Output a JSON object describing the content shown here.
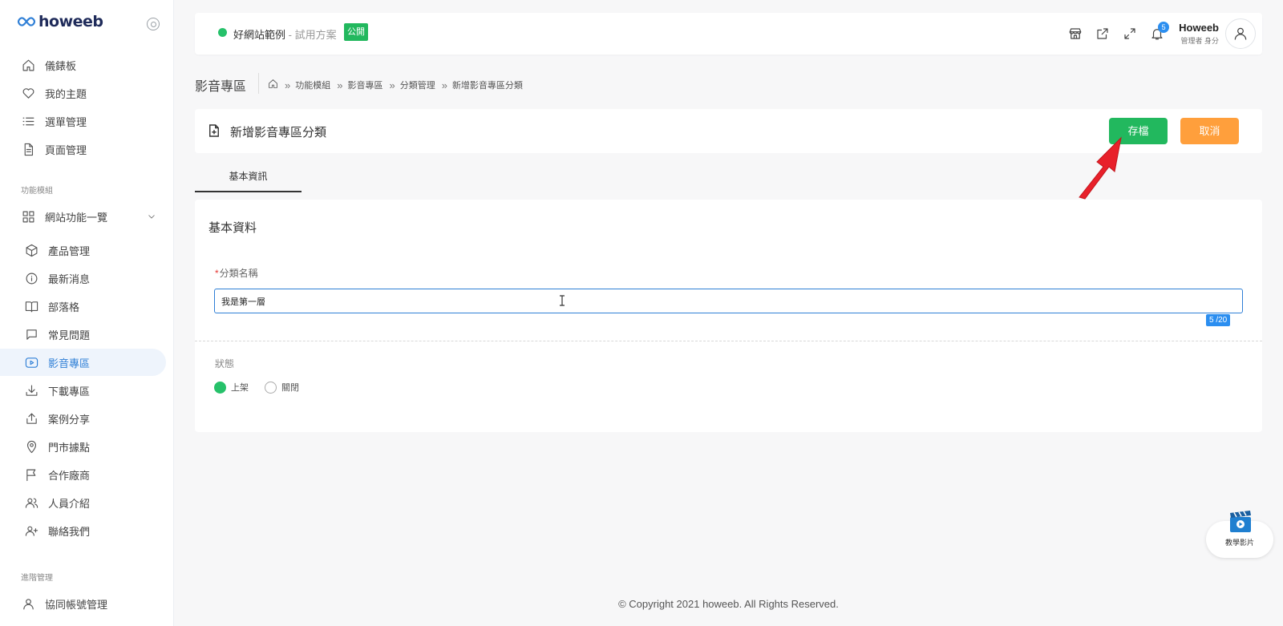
{
  "brand": {
    "logo_text": "howeeb"
  },
  "sidebar": {
    "main_items": [
      {
        "label": "儀錶板",
        "icon": "home-icon"
      },
      {
        "label": "我的主題",
        "icon": "heart-icon"
      },
      {
        "label": "選單管理",
        "icon": "list-icon"
      },
      {
        "label": "頁面管理",
        "icon": "file-icon"
      }
    ],
    "section_modules": "功能模組",
    "group_label": "網站功能一覽",
    "module_items": [
      {
        "label": "產品管理",
        "icon": "box-icon"
      },
      {
        "label": "最新消息",
        "icon": "info-icon"
      },
      {
        "label": "部落格",
        "icon": "book-icon"
      },
      {
        "label": "常見問題",
        "icon": "chat-icon"
      },
      {
        "label": "影音專區",
        "icon": "video-icon",
        "active": true
      },
      {
        "label": "下載專區",
        "icon": "download-icon"
      },
      {
        "label": "案例分享",
        "icon": "share-icon"
      },
      {
        "label": "門市據點",
        "icon": "map-pin-icon"
      },
      {
        "label": "合作廠商",
        "icon": "flag-icon"
      },
      {
        "label": "人員介紹",
        "icon": "users-icon"
      },
      {
        "label": "聯絡我們",
        "icon": "user-plus-icon"
      }
    ],
    "section_advanced": "進階管理",
    "advanced_items": [
      {
        "label": "協同帳號管理",
        "icon": "user-icon"
      }
    ]
  },
  "header": {
    "site_name": "好網站範例",
    "site_plan": " - 試用方案",
    "public_badge": "公開",
    "notification_count": "5",
    "user_name": "Howeeb",
    "user_role": "管理者 身分"
  },
  "breadcrumb": {
    "page_heading": "影音專區",
    "items": [
      "功能模組",
      "影音專區",
      "分類管理",
      "新增影音專區分類"
    ]
  },
  "title_card": {
    "title": "新增影音專區分類",
    "save_label": "存檔",
    "cancel_label": "取消"
  },
  "tabs": [
    "基本資訊"
  ],
  "form": {
    "section_title": "基本資料",
    "field_required_mark": "*",
    "field_label": "分類名稱",
    "field_value": "我是第一層",
    "counter": "5 /20",
    "status_label": "狀態",
    "status_options": [
      "上架",
      "關閉"
    ],
    "status_selected": "上架"
  },
  "footer": {
    "copyright": "© Copyright 2021 howeeb. All Rights Reserved."
  },
  "tutorial": {
    "label": "教學影片"
  },
  "colors": {
    "accent": "#2f7fd6",
    "save": "#22b85e",
    "cancel": "#ff9f3c",
    "status_on": "#26c16a",
    "arrow": "#e8202a"
  }
}
